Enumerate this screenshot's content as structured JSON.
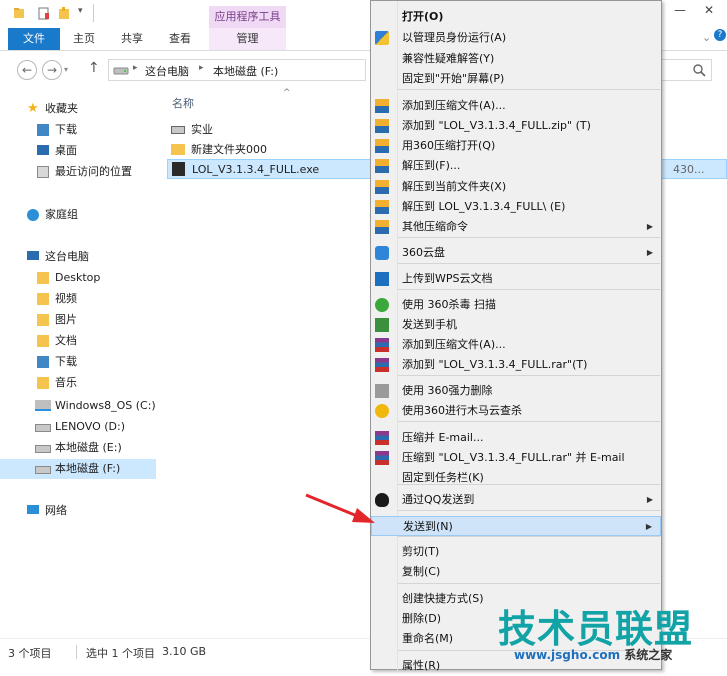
{
  "window": {
    "tool_tab_header": "应用程序工具",
    "controls": {
      "minimize": "—",
      "close": "✕"
    }
  },
  "ribbon": {
    "tabs": [
      {
        "label": "文件"
      },
      {
        "label": "主页"
      },
      {
        "label": "共享"
      },
      {
        "label": "查看"
      },
      {
        "label": "管理"
      }
    ]
  },
  "address": {
    "breadcrumb": [
      "这台电脑",
      "本地磁盘 (F:)"
    ],
    "separator": "▸",
    "back": "←",
    "forward": "→",
    "up": "↑"
  },
  "navpane": {
    "items": [
      {
        "label": "收藏夹",
        "icon": "star-icon",
        "color": "#f2b21c"
      },
      {
        "label": "下载",
        "icon": "download-folder-icon",
        "color": "#3f88c5"
      },
      {
        "label": "桌面",
        "icon": "desktop-icon",
        "color": "#2b6cb0"
      },
      {
        "label": "最近访问的位置",
        "icon": "recent-places-icon",
        "color": "#8a8a8a"
      },
      {
        "label": "家庭组",
        "icon": "homegroup-icon",
        "color": "#2a8fd6"
      },
      {
        "label": "这台电脑",
        "icon": "computer-icon",
        "color": "#2b6cb0"
      },
      {
        "label": "Desktop",
        "icon": "folder-icon",
        "color": "#f4c44f"
      },
      {
        "label": "视频",
        "icon": "videos-folder-icon",
        "color": "#f4c44f"
      },
      {
        "label": "图片",
        "icon": "pictures-folder-icon",
        "color": "#f4c44f"
      },
      {
        "label": "文档",
        "icon": "documents-folder-icon",
        "color": "#f4c44f"
      },
      {
        "label": "下载",
        "icon": "download-folder-icon",
        "color": "#3f88c5"
      },
      {
        "label": "音乐",
        "icon": "music-folder-icon",
        "color": "#f4c44f"
      },
      {
        "label": "Windows8_OS (C:)",
        "icon": "windows-drive-icon",
        "color": "#2b8fe0"
      },
      {
        "label": "LENOVO (D:)",
        "icon": "drive-icon",
        "color": "#8a8a8a"
      },
      {
        "label": "本地磁盘 (E:)",
        "icon": "drive-icon",
        "color": "#8a8a8a"
      },
      {
        "label": "本地磁盘 (F:)",
        "icon": "drive-icon",
        "color": "#8a8a8a"
      },
      {
        "label": "网络",
        "icon": "network-icon",
        "color": "#2a8fd6"
      }
    ]
  },
  "filelist": {
    "column_name": "名称",
    "partial_size_text": "430...",
    "files": [
      {
        "name": "实业",
        "icon": "drive-icon"
      },
      {
        "name": "新建文件夹000",
        "icon": "folder-icon"
      },
      {
        "name": "LOL_V3.1.3.4_FULL.exe",
        "icon": "exe-icon"
      }
    ]
  },
  "status": {
    "count": "3 个项目",
    "selected": "选中 1 个项目",
    "size": "3.10 GB"
  },
  "context_menu": {
    "items": [
      {
        "label": "打开(O)",
        "icon": "",
        "bold": true
      },
      {
        "label": "以管理员身份运行(A)",
        "icon": "uac-shield-icon"
      },
      {
        "label": "兼容性疑难解答(Y)",
        "icon": ""
      },
      {
        "label": "固定到\"开始\"屏幕(P)",
        "icon": ""
      },
      {
        "label": "添加到压缩文件(A)...",
        "icon": "360zip-icon"
      },
      {
        "label": "添加到 \"LOL_V3.1.3.4_FULL.zip\" (T)",
        "icon": "360zip-icon"
      },
      {
        "label": "用360压缩打开(Q)",
        "icon": "360zip-icon"
      },
      {
        "label": "解压到(F)...",
        "icon": "360zip-icon"
      },
      {
        "label": "解压到当前文件夹(X)",
        "icon": "360zip-icon"
      },
      {
        "label": "解压到 LOL_V3.1.3.4_FULL\\ (E)",
        "icon": "360zip-icon"
      },
      {
        "label": "其他压缩命令",
        "icon": "360zip-icon",
        "submenu": true
      },
      {
        "label": "360云盘",
        "icon": "360cloud-icon",
        "submenu": true
      },
      {
        "label": "上传到WPS云文档",
        "icon": "wps-cloud-icon"
      },
      {
        "label": "使用 360杀毒 扫描",
        "icon": "360-antivirus-icon"
      },
      {
        "label": "发送到手机",
        "icon": "send-to-phone-icon"
      },
      {
        "label": "添加到压缩文件(A)...",
        "icon": "winrar-icon"
      },
      {
        "label": "添加到 \"LOL_V3.1.3.4_FULL.rar\"(T)",
        "icon": "winrar-icon"
      },
      {
        "label": "使用 360强力删除",
        "icon": "360-shred-icon"
      },
      {
        "label": "使用360进行木马云查杀",
        "icon": "360-trojan-scan-icon"
      },
      {
        "label": "压缩并 E-mail...",
        "icon": "winrar-icon"
      },
      {
        "label": "压缩到 \"LOL_V3.1.3.4_FULL.rar\" 并 E-mail",
        "icon": "winrar-icon"
      },
      {
        "label": "固定到任务栏(K)",
        "icon": ""
      },
      {
        "label": "通过QQ发送到",
        "icon": "qq-icon",
        "submenu": true
      },
      {
        "label": "发送到(N)",
        "icon": "",
        "submenu": true,
        "highlighted": true
      },
      {
        "label": "剪切(T)",
        "icon": ""
      },
      {
        "label": "复制(C)",
        "icon": ""
      },
      {
        "label": "创建快捷方式(S)",
        "icon": ""
      },
      {
        "label": "删除(D)",
        "icon": ""
      },
      {
        "label": "重命名(M)",
        "icon": ""
      },
      {
        "label": "属性(R)",
        "icon": ""
      }
    ],
    "submenu_arrow": "▶"
  },
  "watermark": {
    "title": "技术员联盟",
    "url": "www.jsgho.com",
    "cn": "系统之家"
  },
  "colors": {
    "accent": "#1979ca",
    "selection": "#cce8ff",
    "menu_bg": "#f0f0f0",
    "arrow_red": "#e2262a"
  }
}
